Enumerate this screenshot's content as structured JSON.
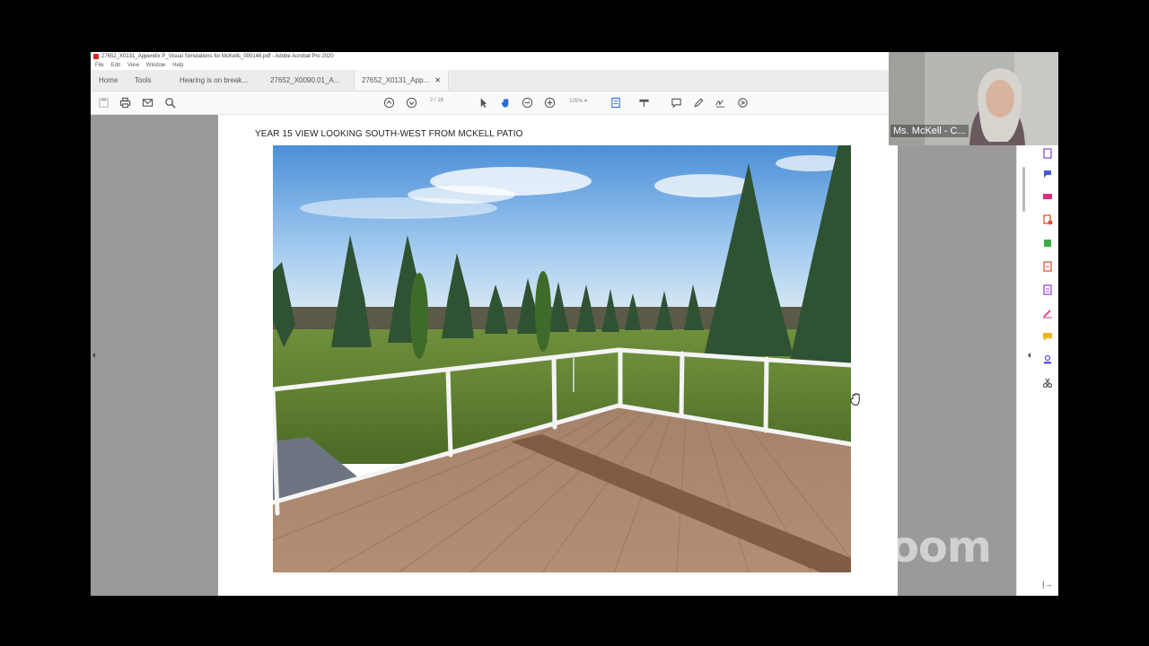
{
  "window": {
    "title": "27652_X0131_Appendix P_Visual Simulations for McKells_000146.pdf - Adobe Acrobat Pro 2020"
  },
  "menu": [
    "File",
    "Edit",
    "View",
    "Window",
    "Help"
  ],
  "tabs": {
    "home": "Home",
    "tools": "Tools",
    "doc1": "Hearing is on break...",
    "doc2": "27652_X0090.01_A...",
    "doc3": "27652_X0131_App..."
  },
  "toolbar": {
    "page_current": "2",
    "page_total": "/ 16",
    "zoom": "105%"
  },
  "document": {
    "heading": "YEAR 15 VIEW LOOKING SOUTH-WEST FROM MCKELL PATIO"
  },
  "video": {
    "participant_name": "Ms. McKell - C..."
  },
  "overlay": {
    "brand": "zoom"
  },
  "colors": {
    "acrobat_red": "#d6282b",
    "page_gray": "#9a9a9a",
    "tool_blue": "#2a6fdb"
  },
  "icons": {
    "toolbar": [
      "save-icon",
      "print-icon",
      "email-icon",
      "search-icon",
      "prev-page-icon",
      "next-page-icon",
      "select-arrow-icon",
      "hand-icon",
      "zoom-out-icon",
      "zoom-in-icon",
      "page-fit-icon",
      "scroll-icon",
      "comment-icon",
      "pen-icon",
      "sign-icon",
      "share-icon"
    ],
    "right_panel": [
      "export-pdf-icon",
      "create-pdf-icon",
      "edit-pdf-icon",
      "combine-files-icon",
      "organize-pages-icon",
      "enhance-scans-icon",
      "protect-icon",
      "fill-sign-icon",
      "comment-tool-icon",
      "stamp-icon",
      "more-tools-icon"
    ]
  }
}
